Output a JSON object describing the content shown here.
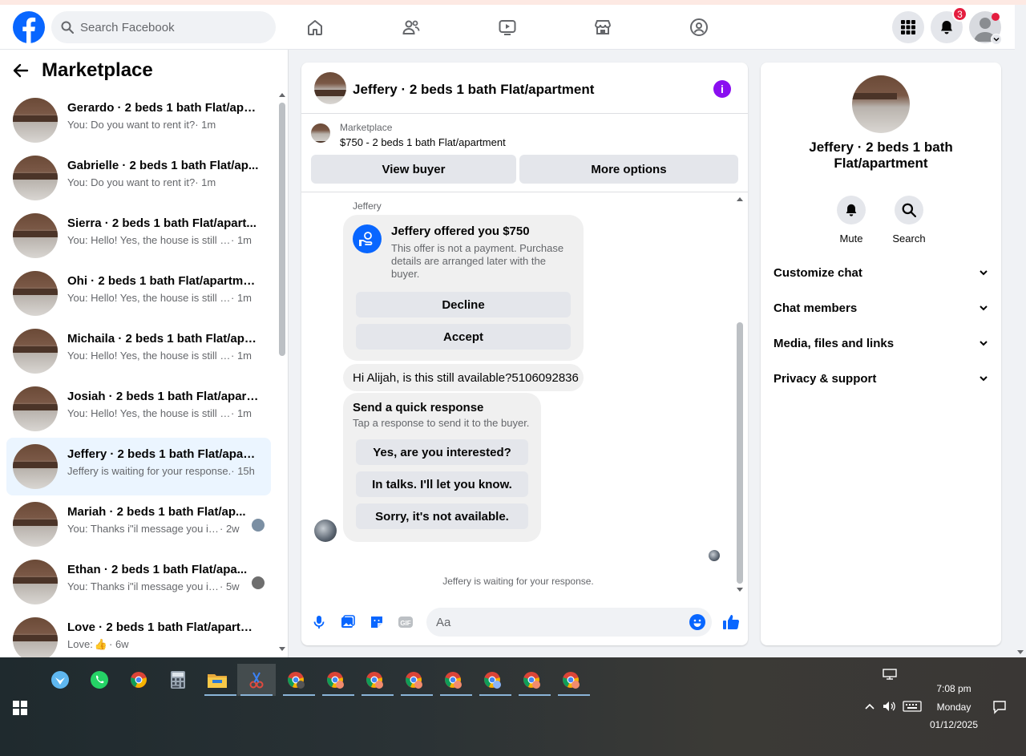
{
  "topbar": {
    "search_placeholder": "Search Facebook",
    "notification_count": "3",
    "brand_color": "#0866ff"
  },
  "sidebar": {
    "title": "Marketplace",
    "conversations": [
      {
        "name": "Gerardo · 2 beds 1 bath Flat/apa...",
        "message": "You: Do you want to rent it?",
        "time": "· 1m"
      },
      {
        "name": "Gabrielle · 2 beds 1 bath Flat/ap...",
        "message": "You: Do you want to rent it?",
        "time": "· 1m"
      },
      {
        "name": "Sierra · 2 beds 1 bath Flat/apart...",
        "message": "You: Hello! Yes, the house is still av...",
        "time": "· 1m"
      },
      {
        "name": "Ohi · 2 beds 1 bath Flat/apartment",
        "message": "You: Hello! Yes, the house is still av...",
        "time": "· 1m"
      },
      {
        "name": "Michaila · 2 beds 1 bath Flat/apa...",
        "message": "You: Hello! Yes, the house is still av...",
        "time": "· 1m"
      },
      {
        "name": "Josiah · 2 beds 1 bath Flat/apart...",
        "message": "You: Hello! Yes, the house is still av...",
        "time": "· 1m"
      },
      {
        "name": "Jeffery · 2 beds 1 bath Flat/apart...",
        "message": "Jeffery is waiting for your response.",
        "time": "· 15h"
      },
      {
        "name": "Mariah · 2 beds 1 bath Flat/ap...",
        "message": "You: Thanks i\"il message you in ...",
        "time": "· 2w"
      },
      {
        "name": "Ethan · 2 beds 1 bath Flat/apa...",
        "message": "You: Thanks i\"il message you in ...",
        "time": "· 5w"
      },
      {
        "name": "Love · 2 beds 1 bath Flat/apartm...",
        "message": "Love:",
        "time": "· 6w"
      }
    ]
  },
  "chat": {
    "title": "Jeffery · 2 beds 1 bath Flat/apartment",
    "listing_label": "Marketplace",
    "listing_price": "$750 - 2 beds 1 bath Flat/apartment",
    "view_buyer": "View buyer",
    "more_options": "More options",
    "sender": "Jeffery",
    "offer_title": "Jeffery offered you $750",
    "offer_desc": "This offer is not a payment. Purchase details are arranged later with the buyer.",
    "decline": "Decline",
    "accept": "Accept",
    "message": "Hi Alijah, is this still available?5106092836",
    "quick_title": "Send a quick response",
    "quick_sub": "Tap a response to send it to the buyer.",
    "quick_1": "Yes, are you interested?",
    "quick_2": "In talks. I'll let you know.",
    "quick_3": "Sorry, it's not available.",
    "waiting": "Jeffery is waiting for your response.",
    "composer_placeholder": "Aa"
  },
  "details": {
    "title": "Jeffery · 2 beds 1 bath Flat/apartment",
    "mute": "Mute",
    "search": "Search",
    "rows": [
      "Customize chat",
      "Chat members",
      "Media, files and links",
      "Privacy & support"
    ]
  },
  "taskbar": {
    "time": "7:08 pm",
    "day": "Monday",
    "date": "01/12/2025"
  }
}
